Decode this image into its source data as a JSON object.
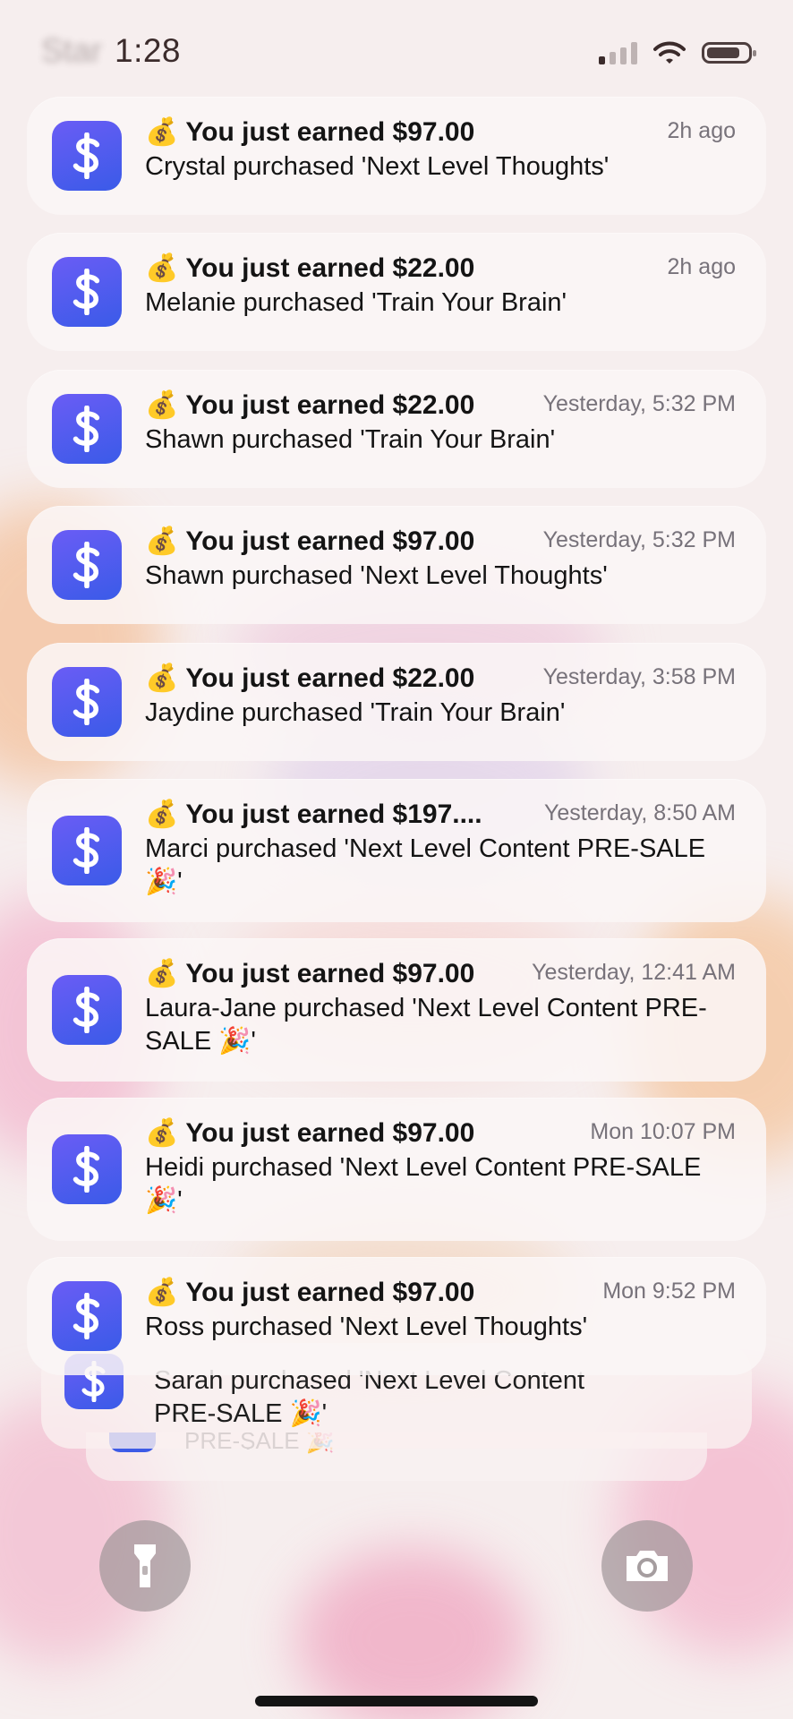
{
  "status_bar": {
    "time": "1:28",
    "ghost_text": "Star"
  },
  "notification_emoji": "💰",
  "notifications": [
    {
      "title": "You just earned $97.00",
      "time": "2h ago",
      "text": "Crystal purchased 'Next Level Thoughts'"
    },
    {
      "title": "You just earned $22.00",
      "time": "2h ago",
      "text": "Melanie purchased 'Train Your Brain'"
    },
    {
      "title": "You just earned $22.00",
      "time": "Yesterday, 5:32 PM",
      "text": "Shawn purchased 'Train Your Brain'"
    },
    {
      "title": "You just earned $97.00",
      "time": "Yesterday, 5:32 PM",
      "text": "Shawn purchased 'Next Level Thoughts'"
    },
    {
      "title": "You just earned $22.00",
      "time": "Yesterday, 3:58 PM",
      "text": "Jaydine purchased 'Train Your Brain'"
    },
    {
      "title": "You just earned $197....",
      "time": "Yesterday, 8:50 AM",
      "text": "Marci purchased 'Next Level Content PRE-SALE 🎉'"
    },
    {
      "title": "You just earned $97.00",
      "time": "Yesterday, 12:41 AM",
      "text": "Laura-Jane purchased 'Next Level Content PRE-SALE 🎉'"
    },
    {
      "title": "You just earned $97.00",
      "time": "Mon 10:07 PM",
      "text": "Heidi purchased 'Next Level Content PRE-SALE 🎉'"
    },
    {
      "title": "You just earned $97.00",
      "time": "Mon 9:52 PM",
      "text": "Ross purchased 'Next Level Thoughts'"
    }
  ],
  "stacked_behind": {
    "text": "Sarah purchased 'Next Level Content PRE-SALE 🎉'",
    "text_second": "PRE-SALE 🎉"
  },
  "icons": {
    "app": "dollar-sign-icon",
    "flashlight": "flashlight-icon",
    "camera": "camera-icon"
  },
  "colors": {
    "app_icon_gradient_start": "#6a5cf5",
    "app_icon_gradient_end": "#3a5be8",
    "card_background": "#faf6f6"
  }
}
